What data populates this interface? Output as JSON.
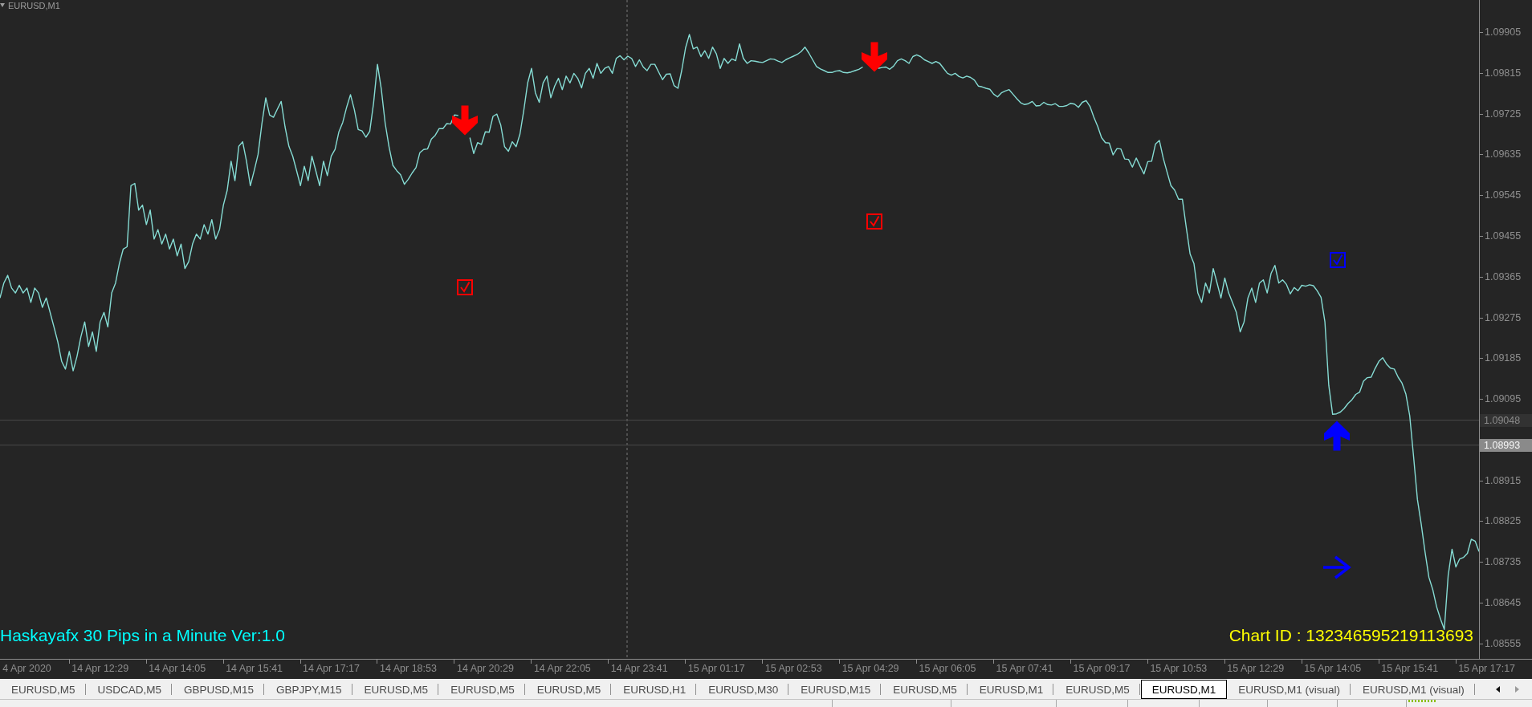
{
  "chart_data": {
    "type": "line",
    "title": "EURUSD,M1",
    "ylim": [
      1.08521,
      1.09976
    ],
    "yticks": [
      1.09905,
      1.09815,
      1.09725,
      1.09635,
      1.09545,
      1.09455,
      1.09365,
      1.09275,
      1.09185,
      1.09095,
      1.08915,
      1.08825,
      1.08735,
      1.08645,
      1.08555
    ],
    "categories": [
      null,
      null,
      null,
      null,
      null,
      null,
      null,
      "4 Apr 2020",
      null,
      null,
      null,
      null,
      null,
      null,
      null,
      null,
      null,
      null,
      null,
      null,
      null,
      null,
      null,
      null,
      null,
      null,
      "14 Apr 12:29",
      null,
      null,
      null,
      null,
      null,
      null,
      null,
      null,
      null,
      null,
      null,
      null,
      null,
      null,
      null,
      null,
      null,
      null,
      null,
      "14 Apr 14:05",
      null,
      null,
      null,
      null,
      null,
      null,
      null,
      null,
      null,
      null,
      null,
      null,
      null,
      null,
      null,
      null,
      null,
      null,
      null,
      "14 Apr 15:41",
      null,
      null,
      null,
      null,
      null,
      null,
      null,
      null,
      null,
      null,
      null,
      null,
      null,
      null,
      null,
      null,
      null,
      null,
      null,
      "14 Apr 17:17",
      null,
      null,
      null,
      null,
      null,
      null,
      null,
      null,
      null,
      null,
      null,
      null,
      null,
      null,
      null,
      null,
      null,
      null,
      null,
      "14 Apr 18:53",
      null,
      null,
      null,
      null,
      null,
      null,
      null,
      null,
      null,
      null,
      null,
      null,
      null,
      null,
      null,
      null,
      null,
      null,
      null,
      "14 Apr 20:29",
      null,
      null,
      null,
      null,
      null,
      null,
      null,
      null,
      null,
      null,
      null,
      null,
      null,
      null,
      null,
      null,
      null,
      null,
      null,
      "14 Apr 22:05",
      null,
      null,
      null,
      null,
      null,
      null,
      null,
      null,
      null,
      null,
      null,
      null,
      null,
      null,
      null,
      null,
      null,
      null,
      null,
      "14 Apr 23:41",
      null,
      null,
      null,
      null,
      null,
      null,
      null,
      null,
      null,
      null,
      null,
      null,
      null,
      null,
      null,
      null,
      null,
      null,
      null,
      "15 Apr 01:17",
      null,
      null,
      null,
      null,
      null,
      null,
      null,
      null,
      null,
      null,
      null,
      null,
      null,
      null,
      null,
      null,
      null,
      null,
      null,
      "15 Apr 02:53",
      null,
      null,
      null,
      null,
      null,
      null,
      null,
      null,
      null,
      null,
      null,
      null,
      null,
      null,
      null,
      null,
      null,
      null,
      null,
      "15 Apr 04:29",
      null,
      null,
      null,
      null,
      null,
      null,
      null,
      null,
      null,
      null,
      null,
      null,
      null,
      null,
      null,
      null,
      null,
      null,
      null,
      "15 Apr 06:05",
      null,
      null,
      null,
      null,
      null,
      null,
      null,
      null,
      null,
      null,
      null,
      null,
      null,
      null,
      null,
      null,
      null,
      null,
      null,
      "15 Apr 07:41",
      null,
      null,
      null,
      null,
      null,
      null,
      null,
      null,
      null,
      null,
      null,
      null,
      null,
      null,
      null,
      null,
      null,
      null,
      null,
      "15 Apr 09:17",
      null,
      null,
      null,
      null,
      null,
      null,
      null,
      null,
      null,
      null,
      null,
      null,
      null,
      null,
      null,
      null,
      null,
      null,
      null,
      "15 Apr 10:53",
      null,
      null,
      null,
      null,
      null,
      null,
      null,
      null,
      null,
      null,
      null,
      null,
      null,
      null,
      null,
      null,
      null,
      null,
      null,
      "15 Apr 12:29",
      null,
      null,
      null,
      null,
      null,
      null,
      null,
      null,
      null,
      null,
      null,
      null,
      null,
      null,
      null,
      null,
      null,
      null,
      null,
      "15 Apr 14:05",
      null,
      null,
      null,
      null,
      null,
      null,
      null,
      null,
      null,
      null,
      null,
      null,
      null,
      null,
      null,
      null,
      null,
      null,
      null,
      "15 Apr 15:41",
      null,
      null,
      null,
      null,
      null,
      null,
      null,
      null,
      null,
      null,
      null,
      null,
      null,
      null,
      null,
      null,
      null,
      null,
      null,
      "15 Apr 17:17"
    ],
    "series": [
      {
        "color": "#86dcd4",
        "values": [
          1.09318,
          1.09351,
          1.09368,
          1.0934,
          1.09329,
          1.09346,
          1.09329,
          1.0934,
          1.09308,
          1.0934,
          1.09329,
          1.09297,
          1.09318,
          1.09286,
          1.09254,
          1.09221,
          1.09178,
          1.09161,
          1.092,
          1.09157,
          1.09189,
          1.09232,
          1.09265,
          1.09211,
          1.09243,
          1.092,
          1.09265,
          1.09286,
          1.09254,
          1.09329,
          1.09351,
          1.09394,
          1.09426,
          1.09431,
          1.09566,
          1.09571,
          1.09512,
          1.09523,
          1.0948,
          1.09512,
          1.09448,
          1.09469,
          1.09437,
          1.09459,
          1.09426,
          1.09448,
          1.09411,
          1.09437,
          1.09383,
          1.09398,
          1.09437,
          1.09459,
          1.09448,
          1.0948,
          1.09459,
          1.09491,
          1.09448,
          1.09469,
          1.09523,
          1.09556,
          1.0962,
          1.09577,
          1.09653,
          1.09663,
          1.0962,
          1.09566,
          1.09599,
          1.09635,
          1.09703,
          1.0976,
          1.09722,
          1.09717,
          1.09735,
          1.09752,
          1.09696,
          1.09653,
          1.09631,
          1.09599,
          1.09566,
          1.09609,
          1.09577,
          1.09631,
          1.09599,
          1.09566,
          1.0962,
          1.09588,
          1.09631,
          1.09646,
          1.09685,
          1.09706,
          1.09739,
          1.09767,
          1.09734,
          1.0969,
          1.09687,
          1.09673,
          1.09686,
          1.09749,
          1.09834,
          1.09779,
          1.09704,
          1.09652,
          1.09611,
          1.09599,
          1.0959,
          1.09569,
          1.0958,
          1.09594,
          1.09606,
          1.09639,
          1.09646,
          1.09647,
          1.09669,
          1.09677,
          1.09692,
          1.09692,
          1.09703,
          1.09702,
          1.09722,
          1.09721,
          null,
          null,
          1.09672,
          1.09637,
          1.09661,
          1.09657,
          1.09685,
          1.09684,
          1.09719,
          1.09724,
          1.097,
          1.09652,
          1.09642,
          1.09663,
          1.09652,
          1.0968,
          1.09733,
          1.09793,
          1.09825,
          1.09771,
          1.0975,
          1.09793,
          1.09808,
          1.0976,
          1.09786,
          1.09803,
          1.09778,
          1.09808,
          1.09793,
          1.09814,
          1.09803,
          1.09782,
          1.09814,
          1.09825,
          1.09803,
          1.09836,
          1.09814,
          1.09825,
          1.09829,
          1.09814,
          1.09847,
          1.09853,
          1.09844,
          1.09852,
          1.09847,
          1.09829,
          1.09844,
          1.09828,
          1.0982,
          1.09834,
          1.09834,
          1.09817,
          1.098,
          1.09812,
          1.09813,
          1.09787,
          1.09781,
          1.0982,
          1.0987,
          1.099,
          1.09868,
          1.09872,
          1.09851,
          1.09864,
          1.09847,
          1.09872,
          1.09857,
          1.09825,
          1.09847,
          1.09836,
          1.09846,
          1.09842,
          1.09879,
          1.09847,
          1.09836,
          1.09842,
          1.09841,
          1.09839,
          1.09838,
          1.09842,
          1.09846,
          1.09845,
          1.09841,
          1.09838,
          1.09844,
          1.09848,
          1.09852,
          1.09856,
          1.09862,
          1.09872,
          1.09859,
          1.09844,
          1.09829,
          1.09824,
          1.0982,
          1.09816,
          1.09816,
          1.09819,
          1.0982,
          1.09816,
          1.09815,
          1.09817,
          1.0982,
          1.09823,
          1.09828,
          null,
          null,
          null,
          1.09825,
          1.09827,
          1.09828,
          1.09823,
          1.0983,
          1.09842,
          1.09846,
          1.09842,
          1.09836,
          1.09851,
          1.09855,
          1.09851,
          1.09844,
          1.0984,
          1.09836,
          1.0984,
          1.09836,
          1.09825,
          1.09814,
          1.0981,
          1.09814,
          1.09807,
          1.09804,
          1.09808,
          1.09805,
          1.09799,
          1.09786,
          1.09784,
          1.09781,
          1.09779,
          1.09768,
          1.09762,
          1.09771,
          1.09775,
          1.09778,
          1.09768,
          1.09758,
          1.09749,
          1.09745,
          1.09747,
          1.09752,
          1.09742,
          1.09743,
          1.0975,
          1.09745,
          1.09744,
          1.09747,
          1.09741,
          1.09741,
          1.09743,
          1.09748,
          1.09746,
          1.09739,
          1.0975,
          1.09754,
          1.09741,
          1.09717,
          1.09697,
          1.09672,
          1.09661,
          1.0966,
          1.09634,
          1.09648,
          1.09647,
          1.09625,
          1.09624,
          1.09607,
          1.09627,
          1.09609,
          1.09592,
          1.09619,
          1.0962,
          1.09658,
          1.09666,
          1.09627,
          1.09596,
          1.09566,
          1.09556,
          1.09536,
          1.09536,
          1.09474,
          1.09415,
          1.09394,
          1.09329,
          1.09308,
          1.09351,
          1.09329,
          1.09383,
          1.09351,
          1.09318,
          1.09362,
          1.09329,
          1.09308,
          1.09286,
          1.09243,
          1.09265,
          1.09318,
          1.0934,
          1.09308,
          1.09351,
          1.09358,
          1.09329,
          1.09372,
          1.0939,
          1.09351,
          1.09358,
          1.09348,
          1.09327,
          1.09341,
          1.09334,
          1.09346,
          1.09344,
          1.09347,
          1.09345,
          1.09334,
          1.09319,
          1.09265,
          1.09125,
          1.09061,
          1.09062,
          1.09066,
          1.09074,
          1.09085,
          1.09093,
          1.09105,
          1.0911,
          1.09134,
          1.09142,
          1.09143,
          1.09162,
          1.09178,
          1.09186,
          1.09172,
          1.09163,
          1.09161,
          1.09143,
          1.0913,
          1.09106,
          1.09058,
          1.08968,
          1.08873,
          1.08819,
          1.08757,
          1.08701,
          1.08674,
          1.08636,
          1.08609,
          1.08586,
          1.08705,
          1.08763,
          1.08724,
          1.08742,
          1.08745,
          1.08754,
          1.08785,
          1.08781,
          1.08758,
          null,
          null
        ]
      }
    ],
    "ref_lines": [
      {
        "axis": "y",
        "value": 1.09048
      },
      {
        "axis": "y",
        "value": 1.08993
      }
    ]
  },
  "price_tags": [
    {
      "label": "1.09048",
      "highlighted": false
    },
    {
      "label": "1.08993",
      "highlighted": true
    }
  ],
  "signals": [
    {
      "kind": "arrow_down",
      "color": "#ff0000"
    },
    {
      "kind": "check",
      "color": "#ff0000"
    },
    {
      "kind": "arrow_down",
      "color": "#ff0000"
    },
    {
      "kind": "check",
      "color": "#ff0000"
    },
    {
      "kind": "check",
      "color": "#0000ff"
    },
    {
      "kind": "arrow_up",
      "color": "#0000ff"
    },
    {
      "kind": "arrow_right",
      "color": "#0000ff"
    }
  ],
  "indicator_labels": [
    {
      "kind": "name",
      "text": "Haskayafx 30 Pips in a Minute Ver:1.0",
      "color": "#00ffff"
    },
    {
      "kind": "chart_id",
      "text": "Chart ID : 132346595219113693",
      "color": "#ffff00"
    }
  ],
  "tabs": [
    {
      "label": "EURUSD,M5",
      "selected": false
    },
    {
      "label": "USDCAD,M5",
      "selected": false
    },
    {
      "label": "GBPUSD,M15",
      "selected": false
    },
    {
      "label": "GBPJPY,M15",
      "selected": false
    },
    {
      "label": "EURUSD,M5",
      "selected": false
    },
    {
      "label": "EURUSD,M5",
      "selected": false
    },
    {
      "label": "EURUSD,M5",
      "selected": false
    },
    {
      "label": "EURUSD,H1",
      "selected": false
    },
    {
      "label": "EURUSD,M30",
      "selected": false
    },
    {
      "label": "EURUSD,M15",
      "selected": false
    },
    {
      "label": "EURUSD,M5",
      "selected": false
    },
    {
      "label": "EURUSD,M1",
      "selected": false
    },
    {
      "label": "EURUSD,M5",
      "selected": false
    },
    {
      "label": "EURUSD,M1",
      "selected": true
    },
    {
      "label": "EURUSD,M1 (visual)",
      "selected": false
    },
    {
      "label": "EURUSD,M1 (visual)",
      "selected": false
    }
  ],
  "tab_scroll_buttons": [
    {
      "kind": "left",
      "disabled": false
    },
    {
      "kind": "right",
      "disabled": true
    }
  ]
}
